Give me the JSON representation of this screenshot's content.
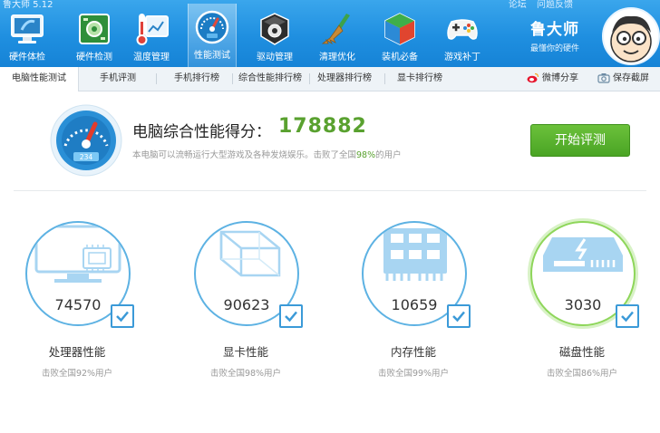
{
  "app": {
    "title": "鲁大师 5.12",
    "top_links": [
      "论坛",
      "问题反馈"
    ],
    "brand_name": "鲁大师",
    "brand_slogan": "最懂你的硬件"
  },
  "toolbar": {
    "items": [
      {
        "label": "硬件体检",
        "icon": "monitor-checkup-icon"
      },
      {
        "label": "硬件检测",
        "icon": "circuit-board-icon"
      },
      {
        "label": "温度管理",
        "icon": "thermometer-chart-icon"
      },
      {
        "label": "性能测试",
        "icon": "speedometer-icon",
        "active": true
      },
      {
        "label": "驱动管理",
        "icon": "driver-gear-icon"
      },
      {
        "label": "清理优化",
        "icon": "broom-icon"
      },
      {
        "label": "装机必备",
        "icon": "package-box-icon"
      },
      {
        "label": "游戏补丁",
        "icon": "gamepad-icon"
      }
    ]
  },
  "tabs": {
    "items": [
      "电脑性能测试",
      "手机评测",
      "手机排行榜",
      "综合性能排行榜",
      "处理器排行榜",
      "显卡排行榜"
    ],
    "active_index": 0,
    "weibo_share": "微博分享",
    "save_screenshot": "保存截屏"
  },
  "score": {
    "title": "电脑综合性能得分：",
    "value": "178882",
    "desc_prefix": "本电脑可以流畅运行大型游戏及各种发烧娱乐。击败了全国",
    "desc_pct": "98%",
    "desc_suffix": "的用户",
    "gauge_readout": "234",
    "start_button": "开始评测"
  },
  "components": [
    {
      "score": "74570",
      "name": "处理器性能",
      "beat": "击败全国92%用户",
      "icon": "processor-monitor-icon",
      "highlighted": false
    },
    {
      "score": "90623",
      "name": "显卡性能",
      "beat": "击败全国98%用户",
      "icon": "graphics-cube-icon",
      "highlighted": false
    },
    {
      "score": "10659",
      "name": "内存性能",
      "beat": "击败全国99%用户",
      "icon": "memory-chip-icon",
      "highlighted": false
    },
    {
      "score": "3030",
      "name": "磁盘性能",
      "beat": "击败全国86%用户",
      "icon": "hard-disk-icon",
      "highlighted": true
    }
  ],
  "colors": {
    "toolbar_blue": "#1f8fe0",
    "score_green": "#59a12f",
    "ring_blue": "#5db2e3",
    "ring_green": "#8ed65a"
  }
}
